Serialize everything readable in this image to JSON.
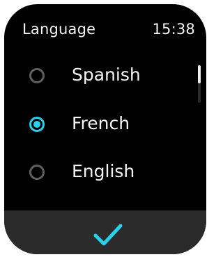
{
  "header": {
    "title": "Language",
    "time": "15:38"
  },
  "languages": [
    {
      "label": "Spanish",
      "selected": false
    },
    {
      "label": "French",
      "selected": true
    },
    {
      "label": "English",
      "selected": false
    }
  ],
  "colors": {
    "accent": "#27d1eb",
    "background": "#000000",
    "bottom_bar": "#2b2b2b",
    "radio_unselected": "#5f5f5f"
  },
  "icons": {
    "confirm": "check-icon"
  }
}
